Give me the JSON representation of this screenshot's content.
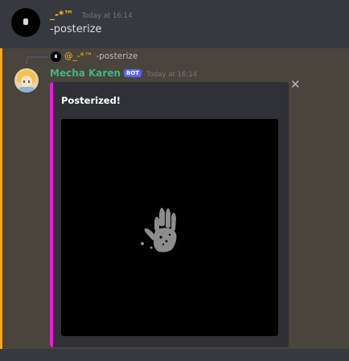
{
  "messages": [
    {
      "username": "_-*™",
      "timestamp": "Today at 16:14",
      "content": "-posterize"
    },
    {
      "reply": {
        "username": "@_-*™",
        "content": "-posterize"
      },
      "username": "Mecha Karen",
      "badge": "BOT",
      "timestamp": "Today at 16:14",
      "embed": {
        "title": "Posterized!",
        "stripe_color": "#e91edb",
        "image_description": "grey handprint on black background"
      }
    }
  ],
  "colors": {
    "background": "#36393f",
    "highlight": "#49443c",
    "mention_bar": "#faa61a",
    "user1": "#f1c40f",
    "user2": "#43b581"
  },
  "icons": {
    "close": "close-icon"
  }
}
